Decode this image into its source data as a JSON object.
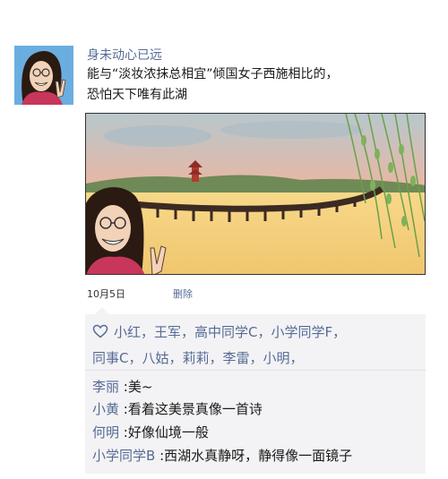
{
  "post": {
    "username": "身未动心已远",
    "text_line1": "能与“淡妆浓抹总相宜”倾国女子西施相比的，",
    "text_line2": "恐怕天下唯有此湖",
    "date": "10月5日",
    "delete_label": "删除"
  },
  "likes": {
    "line1": "小红，王军，高中同学C，小学同学F，",
    "line2": "同事C，八姑，莉莉，李雷，小明，",
    "icon": "heart-icon"
  },
  "comments": [
    {
      "name": "李丽",
      "sep": " :",
      "text": "美~"
    },
    {
      "name": "小黄",
      "sep": " :",
      "text": "看着这美景真像一首诗"
    },
    {
      "name": "何明",
      "sep": " :",
      "text": "好像仙境一般"
    },
    {
      "name": "小学同学B",
      "sep": " :",
      "text": "西湖水真静呀，静得像一面镜子"
    }
  ],
  "colors": {
    "link": "#576b95",
    "comment_bg": "#f3f3f5"
  }
}
